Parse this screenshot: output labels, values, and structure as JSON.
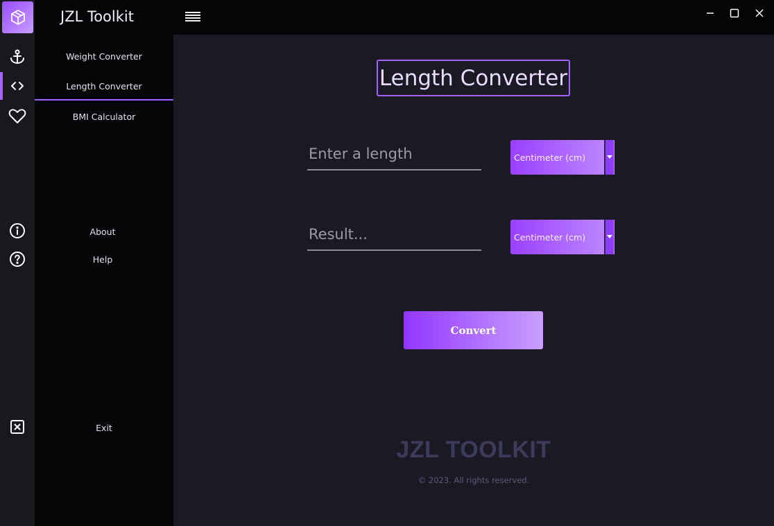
{
  "app": {
    "title": "JZL Toolkit"
  },
  "nav": {
    "items": [
      {
        "label": "Weight Converter",
        "icon": "anchor-icon"
      },
      {
        "label": "Length Converter",
        "icon": "code-icon",
        "active": true
      },
      {
        "label": "BMI Calculator",
        "icon": "heart-icon"
      },
      {
        "label": "About",
        "icon": "info-icon"
      },
      {
        "label": "Help",
        "icon": "help-circle-icon"
      },
      {
        "label": "Exit",
        "icon": "close-box-icon"
      }
    ]
  },
  "window_controls": {
    "minimize": "minimize-icon",
    "maximize": "maximize-icon",
    "close": "close-icon"
  },
  "main": {
    "heading": "Length Converter",
    "input": {
      "placeholder": "Enter a length",
      "value": ""
    },
    "input_unit": "Centimeter (cm)",
    "result": {
      "placeholder": "Result...",
      "value": ""
    },
    "result_unit": "Centimeter (cm)",
    "convert_label": "Convert",
    "brand": "JZL TOOLKIT",
    "copyright": "© 2023. All rights reserved."
  },
  "colors": {
    "accent": "#a463ff",
    "accent_light": "#c79cff",
    "background": "#1a1924",
    "sidebar": "#050407",
    "rail": "#18181f"
  }
}
